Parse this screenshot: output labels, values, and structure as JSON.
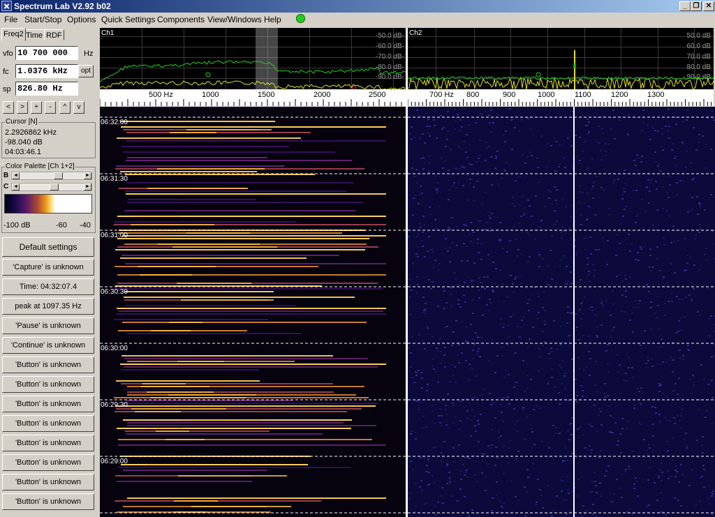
{
  "window": {
    "title": "Spectrum Lab V2.92 b02",
    "minimize": "_",
    "maximize": "❐",
    "close": "✕"
  },
  "menu": [
    "File",
    "Start/Stop",
    "Options",
    "Quick Settings",
    "Components",
    "View/Windows",
    "Help"
  ],
  "tabs": [
    "Freq2",
    "Time",
    "RDF"
  ],
  "fields": {
    "vfo_label": "vfo",
    "vfo_value": "10 700 000",
    "vfo_unit": "Hz",
    "fc_label": "fc",
    "fc_value": "1.0376 kHz",
    "opt_label": "opt",
    "sp_label": "sp",
    "sp_value": "826.80 Hz"
  },
  "nav_buttons": [
    "<",
    ">",
    "+",
    "-",
    "^",
    "v"
  ],
  "cursor": {
    "title": "Cursor [N]",
    "lines": [
      "2.2926862 kHz",
      "-98.040 dB",
      "04:03:46.1"
    ]
  },
  "palette": {
    "title": "Color Palette [Ch 1+2]",
    "b_label": "B",
    "c_label": "C",
    "b_level": 0.62,
    "c_level": 0.55,
    "scale": [
      "-100 dB",
      "-60",
      "-40"
    ]
  },
  "buttons": [
    "Default settings",
    "'Capture' is unknown",
    "Time:  04:32:07.4",
    "peak at 1097.35 Hz",
    "'Pause' is unknown",
    "'Continue' is unknown",
    "'Button' is unknown",
    "'Button' is unknown",
    "'Button' is unknown",
    "'Button' is unknown",
    "'Button' is unknown",
    "'Button' is unknown",
    "'Button' is unknown",
    "'Button' is unknown"
  ],
  "ch1": {
    "label": "Ch1",
    "db_labels": [
      "-50.0 dB-",
      "-60.0 dB-",
      "-70.0 dB-",
      "-80.0 dB-",
      "-90.0 dB-"
    ],
    "freq_labels": [
      "500 Hz",
      "1000",
      "1500",
      "2000",
      "2500"
    ]
  },
  "ch2": {
    "label": "Ch2",
    "db_labels": [
      "50.0 dB",
      "60.0 dB",
      "70.0 dB",
      "80.0 dB",
      "90.0 dB"
    ],
    "freq_labels": [
      "700 Hz",
      "800",
      "900",
      "1000",
      "1100",
      "1200",
      "1300"
    ]
  },
  "waterfall": {
    "times": [
      "06:32:00",
      "06:31:30",
      "06:31:00",
      "06:30:30",
      "06:30:00",
      "06:29:30",
      "06:29:00"
    ]
  },
  "colors": {
    "spectrum_green": "#20d020",
    "spectrum_yellow": "#e0e020",
    "title_start": "#0a246a",
    "title_end": "#a6caf0"
  },
  "icons": {
    "app": "spectrum-lab-app-icon",
    "status": "green-status-indicator-icon"
  }
}
